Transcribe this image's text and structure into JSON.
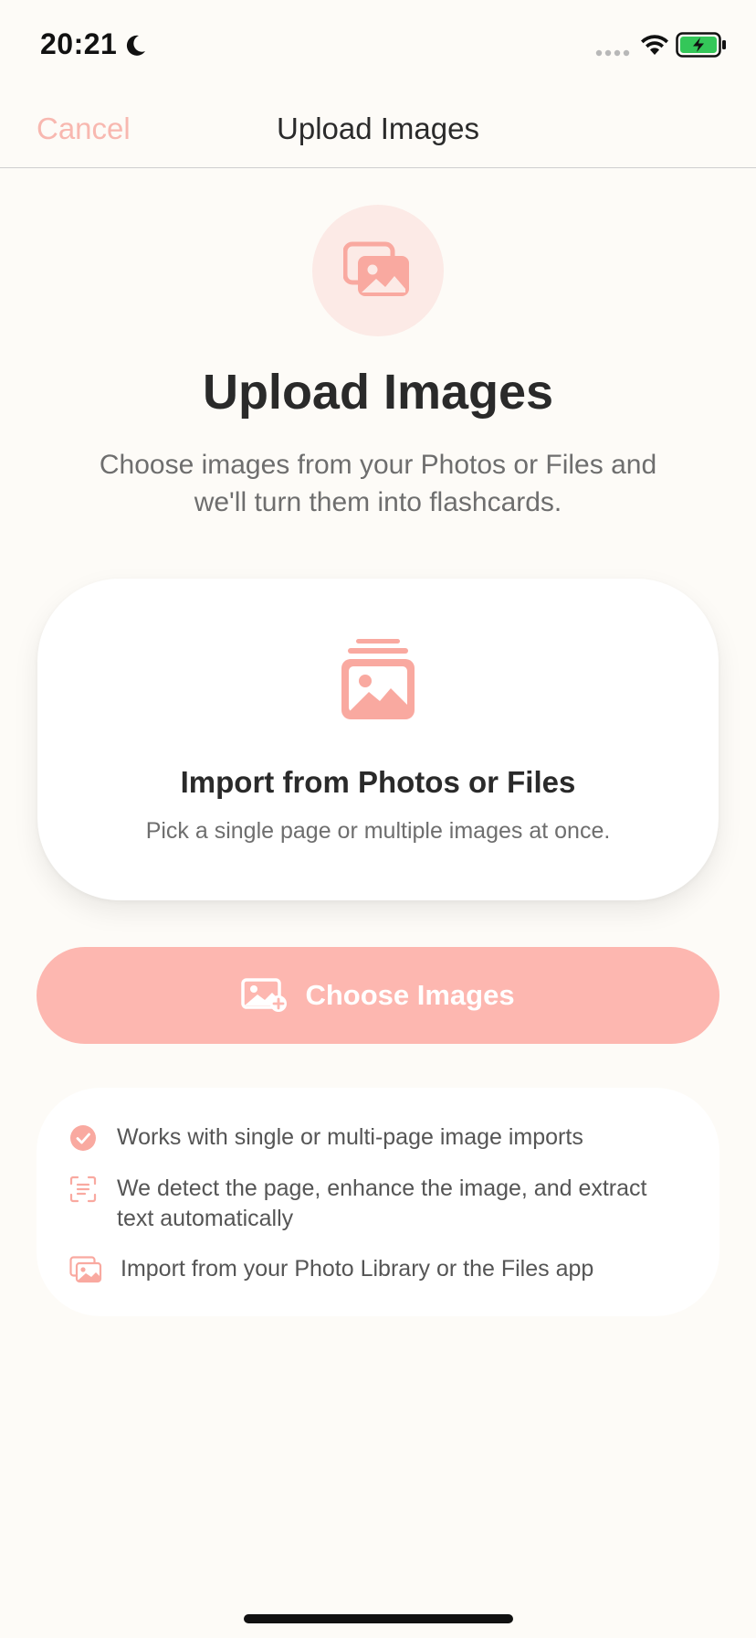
{
  "status_bar": {
    "time": "20:21"
  },
  "nav": {
    "cancel_label": "Cancel",
    "title": "Upload Images"
  },
  "hero": {
    "title": "Upload Images",
    "subtitle": "Choose images from your Photos or Files and we'll turn them into flashcards."
  },
  "card": {
    "title": "Import from Photos or Files",
    "subtitle": "Pick a single page or multiple images at once."
  },
  "primary_button": {
    "label": "Choose Images",
    "icon": "image-add-icon"
  },
  "features": [
    {
      "icon": "checkmark-circle-icon",
      "text": "Works with single or multi-page image imports"
    },
    {
      "icon": "document-scan-icon",
      "text": "We detect the page, enhance the image, and extract text automatically"
    },
    {
      "icon": "photos-icon",
      "text": "Import from your Photo Library or the Files app"
    }
  ],
  "colors": {
    "accent": "#FDB7B0",
    "accent_icon": "#F9A9A0",
    "accent_light": "#FCEAE6",
    "background": "#FDFBF7",
    "text_primary": "#2A2A2A",
    "text_secondary": "#6E6E6E"
  }
}
